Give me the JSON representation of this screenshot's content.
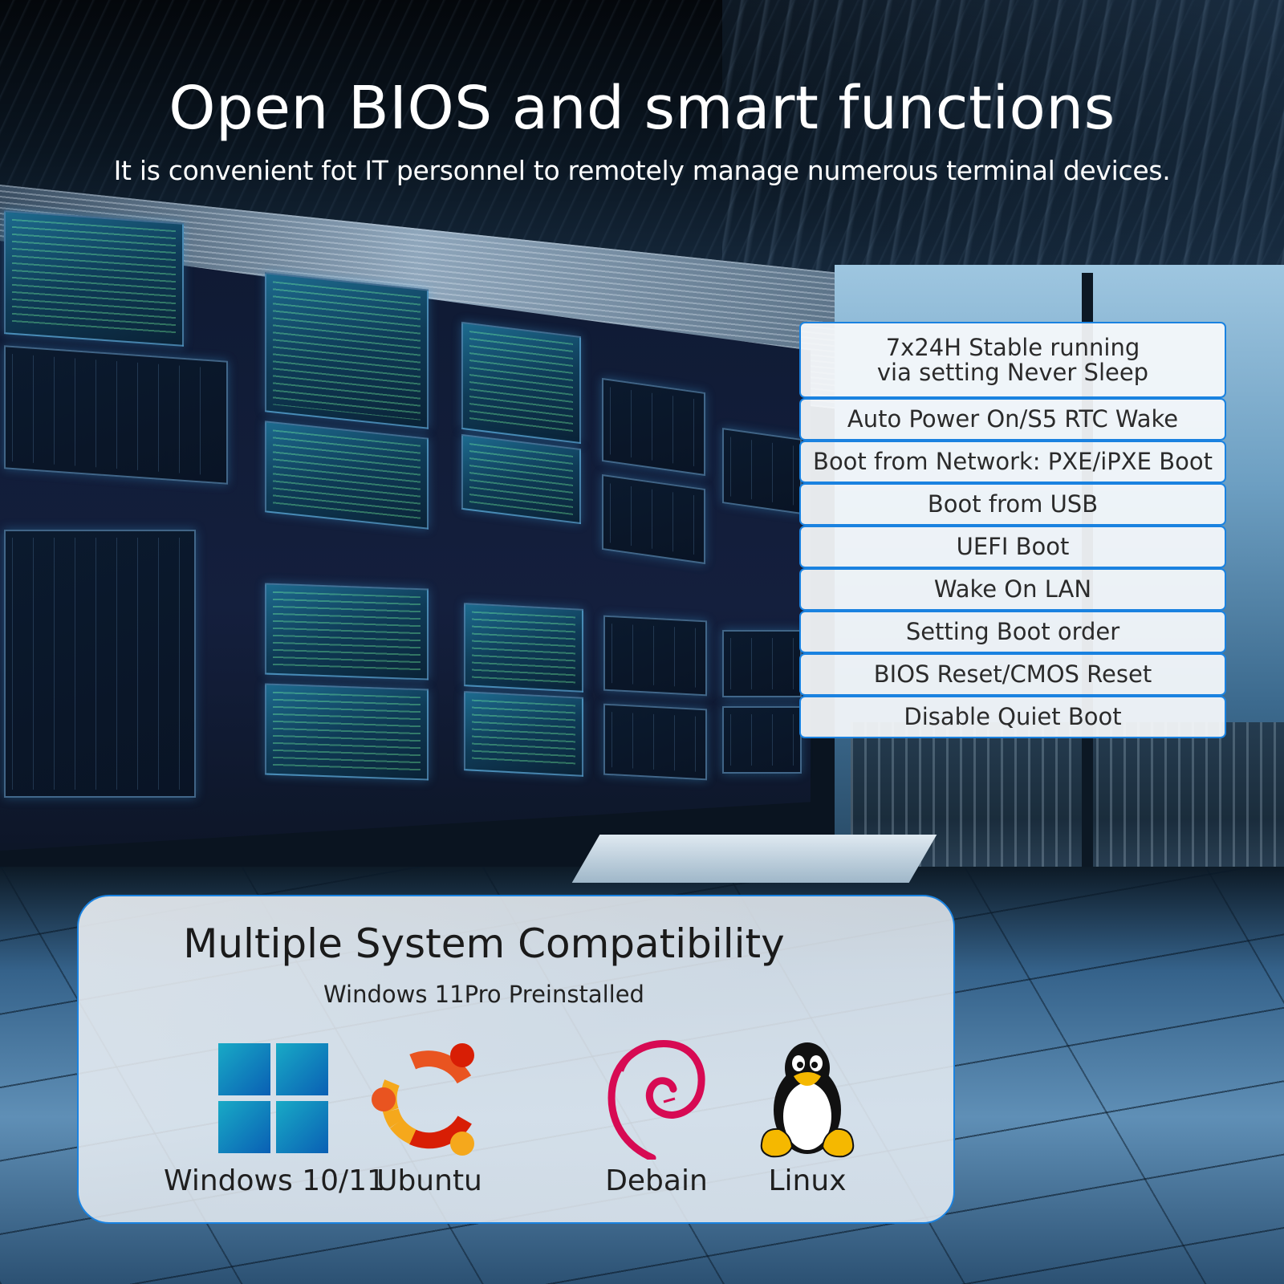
{
  "header": {
    "title": "Open BIOS and smart functions",
    "subtitle": "It is convenient fot IT personnel to remotely manage numerous terminal devices."
  },
  "features": {
    "items": [
      {
        "line1": "7x24H Stable running",
        "line2": "via setting Never Sleep"
      },
      {
        "label": "Auto Power On/S5 RTC Wake"
      },
      {
        "label": "Boot from Network: PXE/iPXE Boot"
      },
      {
        "label": "Boot from USB"
      },
      {
        "label": "UEFI Boot"
      },
      {
        "label": "Wake On LAN"
      },
      {
        "label": "Setting Boot order"
      },
      {
        "label": "BIOS Reset/CMOS Reset"
      },
      {
        "label": "Disable Quiet Boot"
      }
    ],
    "border_color": "#1a82e0"
  },
  "compatibility": {
    "title": "Multiple System Compatibility",
    "subtitle": "Windows 11Pro Preinstalled",
    "systems": [
      {
        "label": "Windows 10/11",
        "icon": "windows-logo-icon"
      },
      {
        "label": "Ubuntu",
        "icon": "ubuntu-logo-icon"
      },
      {
        "label": "Debain",
        "icon": "debian-logo-icon"
      },
      {
        "label": "Linux",
        "icon": "linux-tux-icon"
      }
    ]
  },
  "colors": {
    "accent_blue": "#1a82e0",
    "windows_blue": "#0f7bc8",
    "ubuntu_orange": "#e95420",
    "ubuntu_yellow": "#f5a81c",
    "ubuntu_red": "#d81e05",
    "debian_red": "#d70a53"
  }
}
